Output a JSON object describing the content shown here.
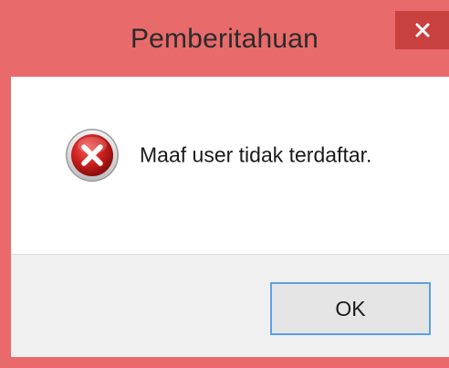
{
  "dialog": {
    "title": "Pemberitahuan",
    "message": "Maaf user tidak terdaftar.",
    "icon": "error-icon",
    "buttons": {
      "ok_label": "OK"
    }
  },
  "colors": {
    "title_bar": "#e96a6a",
    "close_button": "#c8413f",
    "button_focus_border": "#5ba0e6"
  },
  "icons": {
    "close": "close-icon",
    "error": "error-icon"
  }
}
